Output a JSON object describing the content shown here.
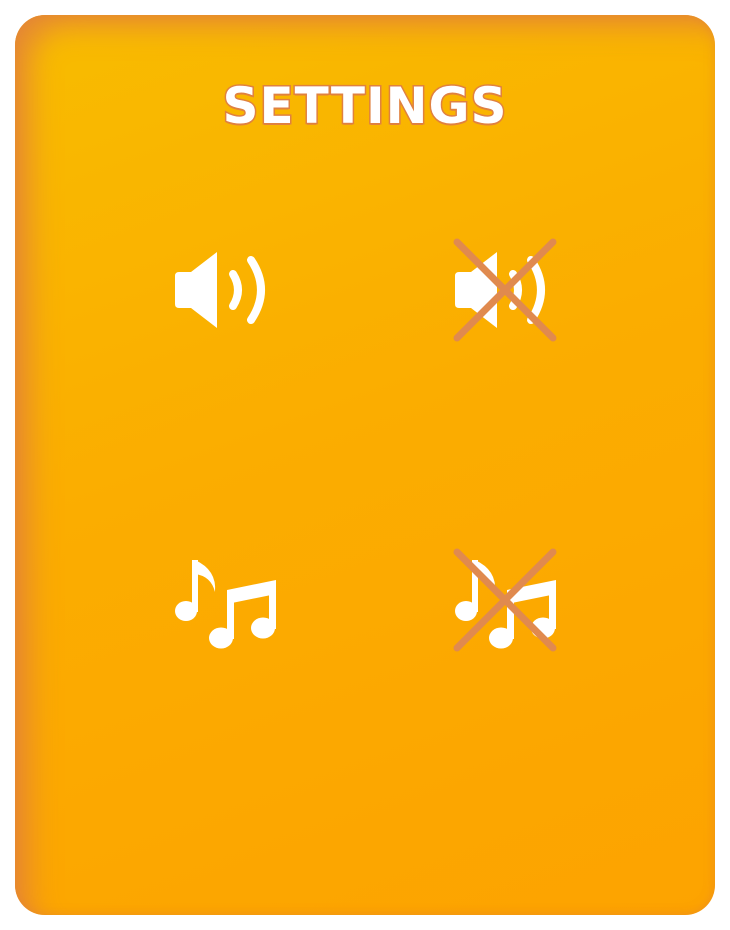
{
  "settings": {
    "title": "SETTINGS"
  },
  "icons": {
    "sound_on": "speaker-on-icon",
    "sound_off": "speaker-muted-icon",
    "music_on": "music-notes-icon",
    "music_off": "music-notes-muted-icon"
  },
  "colors": {
    "panel_top": "#f8bc00",
    "panel_bottom": "#fda300",
    "panel_edge": "#e2803c",
    "icon": "#ffffff",
    "strike": "#e08a4f"
  }
}
